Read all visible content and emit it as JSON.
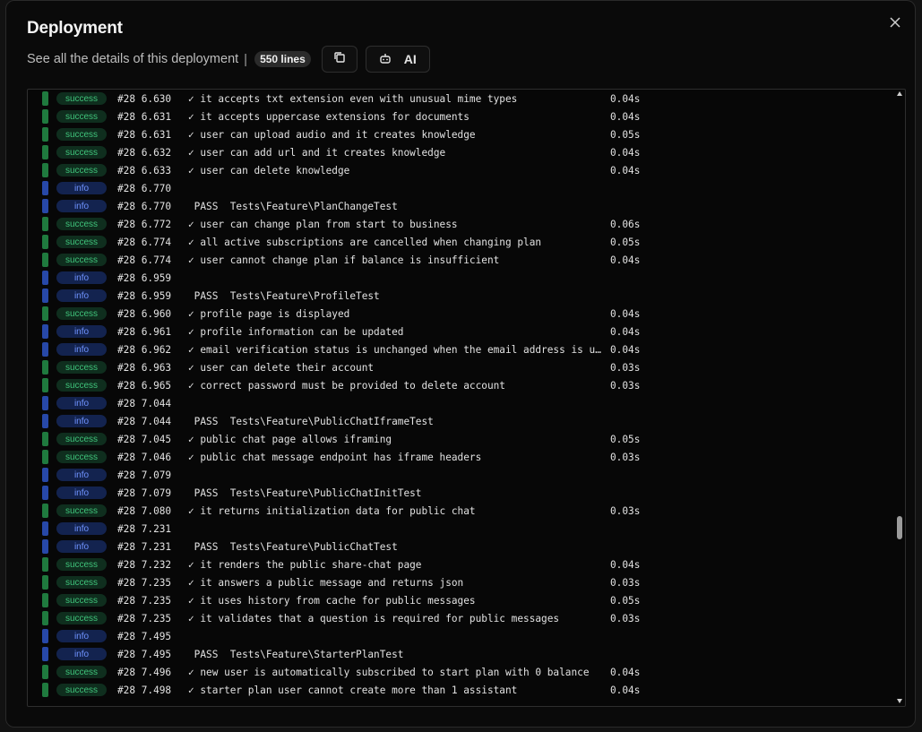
{
  "modal": {
    "title": "Deployment",
    "subtitle": "See all the details of this deployment",
    "separator": "|",
    "line_count": "550 lines",
    "ai_label": "AI",
    "close_icon": "close-icon",
    "copy_icon": "copy-icon",
    "ai_icon": "robot-icon"
  },
  "colors": {
    "success": "#1f7a3e",
    "info": "#2748a8"
  },
  "log": [
    {
      "level": "success",
      "ts": "#28 6.630",
      "msg": "✓ it accepts txt extension even with unusual mime types",
      "dur": "0.04s"
    },
    {
      "level": "success",
      "ts": "#28 6.631",
      "msg": "✓ it accepts uppercase extensions for documents",
      "dur": "0.04s"
    },
    {
      "level": "success",
      "ts": "#28 6.631",
      "msg": "✓ user can upload audio and it creates knowledge",
      "dur": "0.05s"
    },
    {
      "level": "success",
      "ts": "#28 6.632",
      "msg": "✓ user can add url and it creates knowledge",
      "dur": "0.04s"
    },
    {
      "level": "success",
      "ts": "#28 6.633",
      "msg": "✓ user can delete knowledge",
      "dur": "0.04s"
    },
    {
      "level": "info",
      "ts": "#28 6.770",
      "msg": "",
      "dur": ""
    },
    {
      "level": "info",
      "ts": "#28 6.770",
      "msg": " PASS  Tests\\Feature\\PlanChangeTest",
      "dur": ""
    },
    {
      "level": "success",
      "ts": "#28 6.772",
      "msg": "✓ user can change plan from start to business",
      "dur": "0.06s"
    },
    {
      "level": "success",
      "ts": "#28 6.774",
      "msg": "✓ all active subscriptions are cancelled when changing plan",
      "dur": "0.05s"
    },
    {
      "level": "success",
      "ts": "#28 6.774",
      "msg": "✓ user cannot change plan if balance is insufficient",
      "dur": "0.04s"
    },
    {
      "level": "info",
      "ts": "#28 6.959",
      "msg": "",
      "dur": ""
    },
    {
      "level": "info",
      "ts": "#28 6.959",
      "msg": " PASS  Tests\\Feature\\ProfileTest",
      "dur": ""
    },
    {
      "level": "success",
      "ts": "#28 6.960",
      "msg": "✓ profile page is displayed",
      "dur": "0.04s"
    },
    {
      "level": "info",
      "ts": "#28 6.961",
      "msg": "✓ profile information can be updated",
      "dur": "0.04s"
    },
    {
      "level": "info",
      "ts": "#28 6.962",
      "msg": "✓ email verification status is unchanged when the email address is un…",
      "dur": "0.04s"
    },
    {
      "level": "success",
      "ts": "#28 6.963",
      "msg": "✓ user can delete their account",
      "dur": "0.03s"
    },
    {
      "level": "success",
      "ts": "#28 6.965",
      "msg": "✓ correct password must be provided to delete account",
      "dur": "0.03s"
    },
    {
      "level": "info",
      "ts": "#28 7.044",
      "msg": "",
      "dur": ""
    },
    {
      "level": "info",
      "ts": "#28 7.044",
      "msg": " PASS  Tests\\Feature\\PublicChatIframeTest",
      "dur": ""
    },
    {
      "level": "success",
      "ts": "#28 7.045",
      "msg": "✓ public chat page allows iframing",
      "dur": "0.05s"
    },
    {
      "level": "success",
      "ts": "#28 7.046",
      "msg": "✓ public chat message endpoint has iframe headers",
      "dur": "0.03s"
    },
    {
      "level": "info",
      "ts": "#28 7.079",
      "msg": "",
      "dur": ""
    },
    {
      "level": "info",
      "ts": "#28 7.079",
      "msg": " PASS  Tests\\Feature\\PublicChatInitTest",
      "dur": ""
    },
    {
      "level": "success",
      "ts": "#28 7.080",
      "msg": "✓ it returns initialization data for public chat",
      "dur": "0.03s"
    },
    {
      "level": "info",
      "ts": "#28 7.231",
      "msg": "",
      "dur": ""
    },
    {
      "level": "info",
      "ts": "#28 7.231",
      "msg": " PASS  Tests\\Feature\\PublicChatTest",
      "dur": ""
    },
    {
      "level": "success",
      "ts": "#28 7.232",
      "msg": "✓ it renders the public share-chat page",
      "dur": "0.04s"
    },
    {
      "level": "success",
      "ts": "#28 7.235",
      "msg": "✓ it answers a public message and returns json",
      "dur": "0.03s"
    },
    {
      "level": "success",
      "ts": "#28 7.235",
      "msg": "✓ it uses history from cache for public messages",
      "dur": "0.05s"
    },
    {
      "level": "success",
      "ts": "#28 7.235",
      "msg": "✓ it validates that a question is required for public messages",
      "dur": "0.03s"
    },
    {
      "level": "info",
      "ts": "#28 7.495",
      "msg": "",
      "dur": ""
    },
    {
      "level": "info",
      "ts": "#28 7.495",
      "msg": " PASS  Tests\\Feature\\StarterPlanTest",
      "dur": ""
    },
    {
      "level": "success",
      "ts": "#28 7.496",
      "msg": "✓ new user is automatically subscribed to start plan with 0 balance",
      "dur": "0.04s"
    },
    {
      "level": "success",
      "ts": "#28 7.498",
      "msg": "✓ starter plan user cannot create more than 1 assistant",
      "dur": "0.04s"
    }
  ]
}
